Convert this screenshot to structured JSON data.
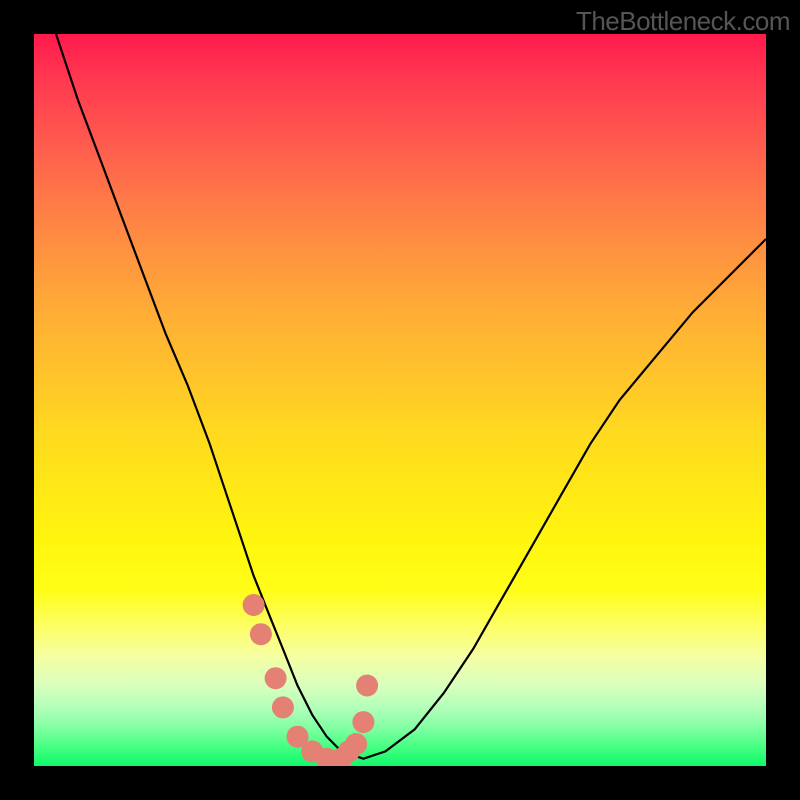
{
  "watermark": "TheBottleneck.com",
  "chart_data": {
    "type": "line",
    "title": "",
    "xlabel": "",
    "ylabel": "",
    "xlim": [
      0,
      100
    ],
    "ylim": [
      0,
      100
    ],
    "background_gradient": {
      "top_color": "#ff1a4d",
      "mid_color": "#ffe816",
      "bottom_color": "#11f76a"
    },
    "series": [
      {
        "name": "curve",
        "color": "#000000",
        "x": [
          3,
          6,
          9,
          12,
          15,
          18,
          21,
          24,
          26,
          28,
          30,
          32,
          34,
          36,
          38,
          40,
          42,
          45,
          48,
          52,
          56,
          60,
          64,
          68,
          72,
          76,
          80,
          85,
          90,
          95,
          100
        ],
        "y": [
          100,
          91,
          83,
          75,
          67,
          59,
          52,
          44,
          38,
          32,
          26,
          21,
          16,
          11,
          7,
          4,
          2,
          1,
          2,
          5,
          10,
          16,
          23,
          30,
          37,
          44,
          50,
          56,
          62,
          67,
          72
        ]
      },
      {
        "name": "highlight-dots",
        "color": "#e58074",
        "x": [
          30,
          31,
          33,
          34,
          36,
          38,
          40,
          42,
          43,
          44,
          45,
          45.5
        ],
        "y": [
          22,
          18,
          12,
          8,
          4,
          2,
          1,
          1,
          2,
          3,
          6,
          11
        ]
      }
    ]
  }
}
